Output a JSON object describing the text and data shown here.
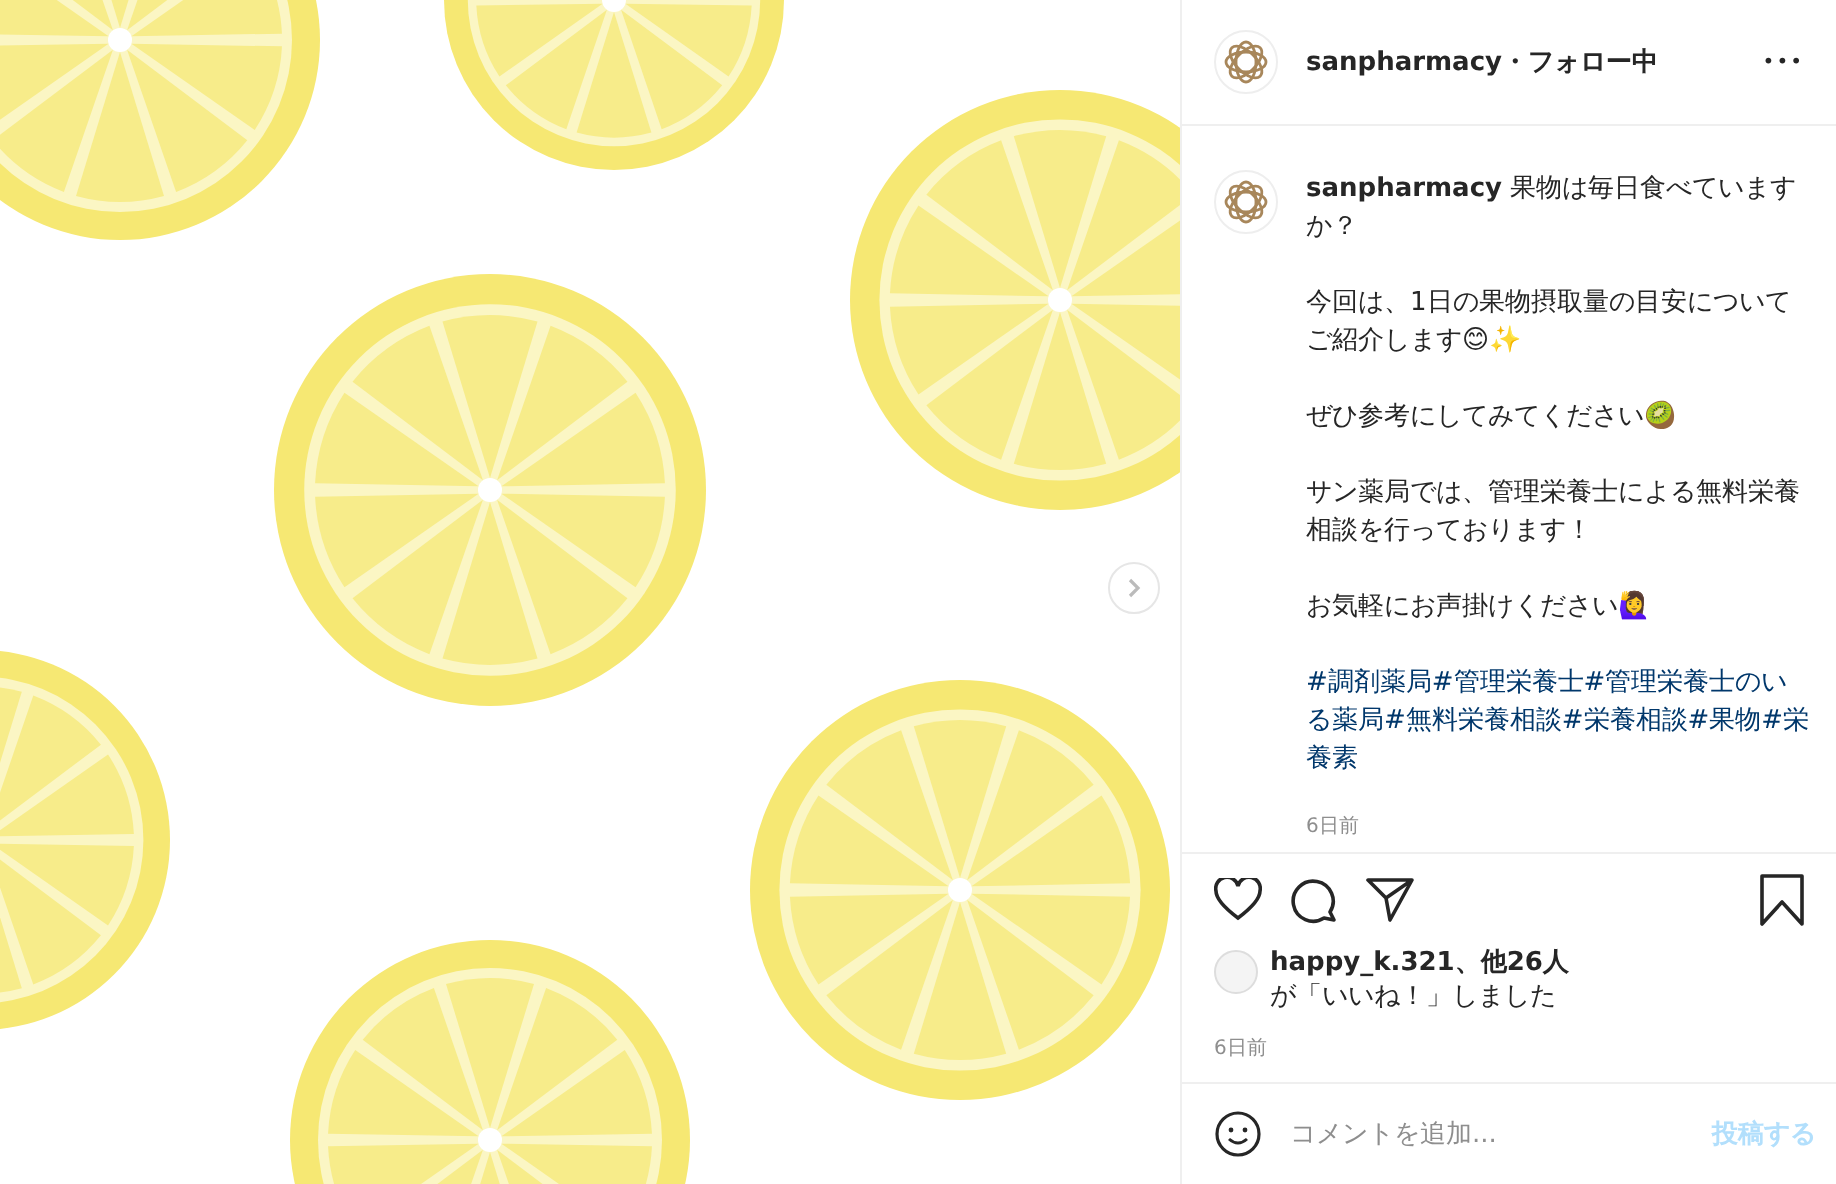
{
  "post_image": {
    "next_button": true
  },
  "header": {
    "username": "sanpharmacy",
    "separator": "・",
    "follow_status": "フォロー中",
    "more": "•••"
  },
  "caption": {
    "paragraphs": [
      {
        "kind": "text",
        "text": "**sanpharmacy** 果物は毎日食べていますか？"
      },
      {
        "kind": "text",
        "text": "今回は、1日の果物摂取量の目安についてご紹介します😊✨"
      },
      {
        "kind": "text",
        "text": "ぜひ参考にしてみてください🥝"
      },
      {
        "kind": "text",
        "text": "サン薬局では、管理栄養士による無料栄養相談を行っております！"
      },
      {
        "kind": "text",
        "text": "お気軽にお声掛けください🙋‍♀️"
      },
      {
        "kind": "hashtags",
        "text": "#調剤薬局#管理栄養士#管理栄養士のいる薬局#無料栄養相談#栄養相談#果物#栄養素"
      }
    ],
    "time": "6日前"
  },
  "actions": {
    "liked": false,
    "saved": false
  },
  "likes": {
    "user": "happy_k.321、他26人",
    "text": "が「いいね！」しました"
  },
  "time": "6日前",
  "comment": {
    "placeholder": "コメントを追加...",
    "submit": "投稿する"
  }
}
